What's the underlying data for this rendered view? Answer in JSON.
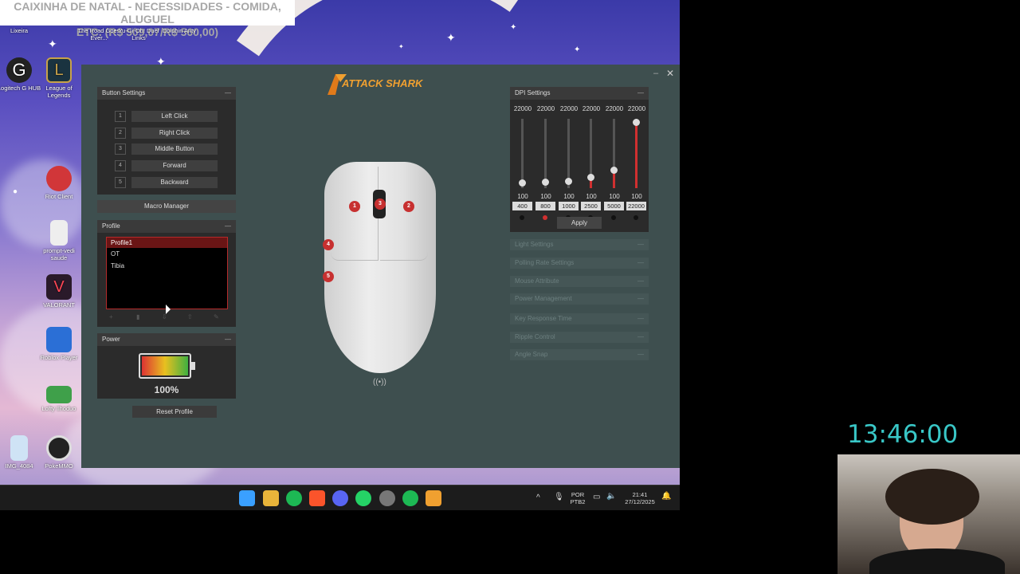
{
  "banner": {
    "text": "CAIXINHA DE NATAL - NECESSIDADES - COMIDA, ALUGUEL\nETC. (R$ 509,07/R$ 560,00)"
  },
  "desktop_icons": [
    {
      "label": "Lixeira",
      "icon": "recycle-bin-icon"
    },
    {
      "label": "The Road Goes Ever...",
      "icon": "game-icon"
    },
    {
      "label": "Yu-Gi-Oh! Duel Links",
      "icon": "game-icon"
    },
    {
      "label": "Dolphin Anty",
      "icon": "browser-icon"
    },
    {
      "label": "Logitech G HUB",
      "icon": "logitech-icon"
    },
    {
      "label": "League of Legends",
      "icon": "league-icon"
    },
    {
      "label": "Riot Client",
      "icon": "riot-icon"
    },
    {
      "label": "prompt-vedi saude",
      "icon": "file-icon"
    },
    {
      "label": "VALORANT",
      "icon": "valorant-icon"
    },
    {
      "label": "Roblox Player",
      "icon": "roblox-icon"
    },
    {
      "label": "Lofty Ilhoduo",
      "icon": "game-icon"
    },
    {
      "label": "IMG_4084",
      "icon": "image-icon"
    },
    {
      "label": "PokeMMO",
      "icon": "pokeball-icon"
    }
  ],
  "app": {
    "logo_text": "ATTACK SHARK",
    "button_settings": {
      "title": "Button Settings",
      "buttons": [
        {
          "num": "1",
          "label": "Left Click"
        },
        {
          "num": "2",
          "label": "Right Click"
        },
        {
          "num": "3",
          "label": "Middle Button"
        },
        {
          "num": "4",
          "label": "Forward"
        },
        {
          "num": "5",
          "label": "Backward"
        }
      ]
    },
    "macro_manager": "Macro Manager",
    "profile": {
      "title": "Profile",
      "items": [
        "Profile1",
        "OT",
        "Tibia"
      ]
    },
    "power": {
      "title": "Power",
      "level_text": "100%",
      "level": 1.0
    },
    "reset_profile": "Reset Profile",
    "dpi": {
      "title": "DPI Settings",
      "apply": "Apply",
      "stages": [
        {
          "top": "22000",
          "polling": "100",
          "value": "400",
          "level": 0.018
        },
        {
          "top": "22000",
          "polling": "100",
          "value": "800",
          "level": 0.036
        },
        {
          "top": "22000",
          "polling": "100",
          "value": "1000",
          "level": 0.045
        },
        {
          "top": "22000",
          "polling": "100",
          "value": "2500",
          "level": 0.114
        },
        {
          "top": "22000",
          "polling": "100",
          "value": "5000",
          "level": 0.227
        },
        {
          "top": "22000",
          "polling": "100",
          "value": "22000",
          "level": 1.0
        }
      ],
      "active_index": 1
    },
    "settings": [
      "Light Settings",
      "Polling Rate Settings",
      "Mouse Attribute",
      "Power Management",
      "Key Response Time",
      "Ripple Control",
      "Angle Snap"
    ],
    "mouse_badges": [
      "1",
      "2",
      "3",
      "4",
      "5"
    ]
  },
  "taskbar": {
    "lang1": "POR",
    "lang2": "PTB2",
    "time": "21:41",
    "date": "27/12/2025"
  },
  "timer": "13:46:00",
  "colors": {
    "accent": "#d03030",
    "app_bg": "#3e4f4f",
    "timer": "#39c7c7"
  }
}
